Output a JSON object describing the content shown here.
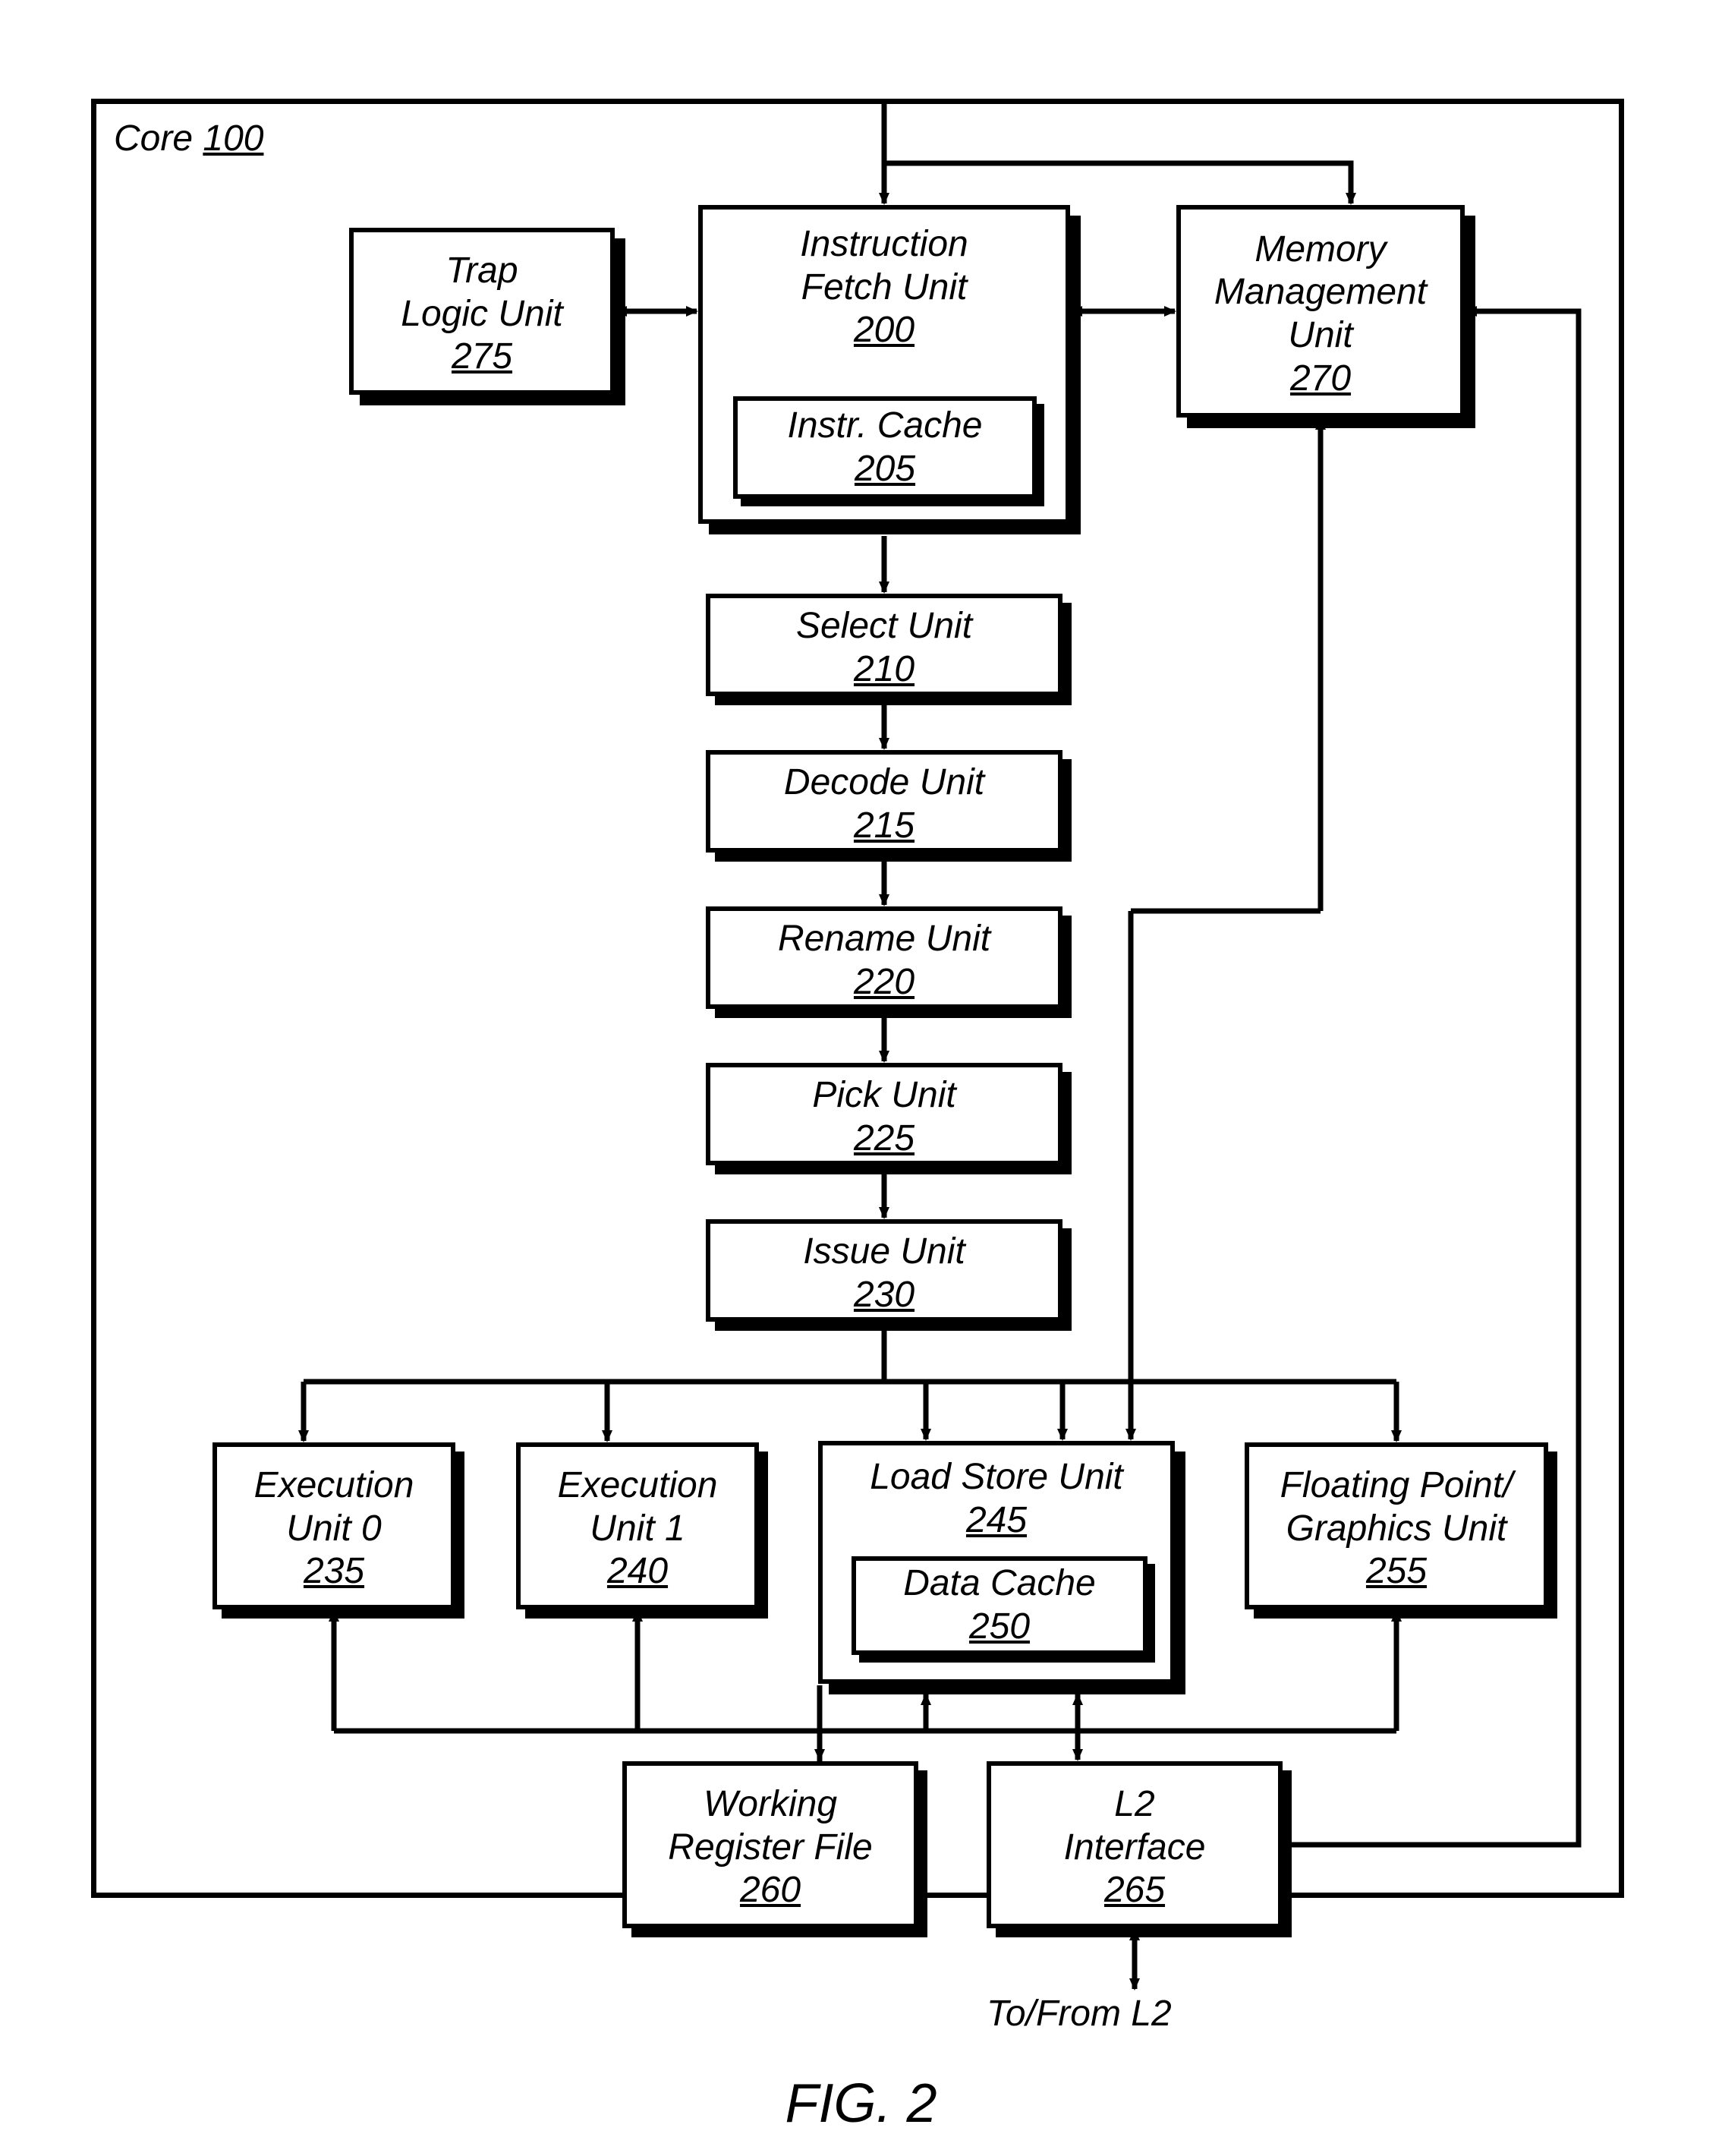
{
  "figure_label": "FIG. 2",
  "core": {
    "label_prefix": "Core ",
    "ref": "100"
  },
  "bottom_label": "To/From L2",
  "blocks": {
    "tlu": {
      "l1": "Trap",
      "l2": "Logic Unit",
      "ref": "275"
    },
    "ifu": {
      "l1": "Instruction",
      "l2": "Fetch Unit",
      "ref": "200"
    },
    "icache": {
      "l1": "Instr. Cache",
      "ref": "205"
    },
    "mmu": {
      "l1": "Memory",
      "l2": "Management",
      "l3": "Unit",
      "ref": "270"
    },
    "select": {
      "l1": "Select Unit",
      "ref": "210"
    },
    "decode": {
      "l1": "Decode Unit",
      "ref": "215"
    },
    "rename": {
      "l1": "Rename Unit",
      "ref": "220"
    },
    "pick": {
      "l1": "Pick Unit",
      "ref": "225"
    },
    "issue": {
      "l1": "Issue Unit",
      "ref": "230"
    },
    "exu0": {
      "l1": "Execution",
      "l2": "Unit 0",
      "ref": "235"
    },
    "exu1": {
      "l1": "Execution",
      "l2": "Unit 1",
      "ref": "240"
    },
    "lsu": {
      "l1": "Load Store Unit",
      "ref": "245"
    },
    "dcache": {
      "l1": "Data Cache",
      "ref": "250"
    },
    "fgu": {
      "l1": "Floating Point/",
      "l2": "Graphics Unit",
      "ref": "255"
    },
    "wrf": {
      "l1": "Working",
      "l2": "Register File",
      "ref": "260"
    },
    "l2if": {
      "l1": "L2",
      "l2": "Interface",
      "ref": "265"
    }
  },
  "chart_data": {
    "type": "diagram",
    "title": "Core 100 block diagram",
    "nodes": [
      {
        "id": "tlu",
        "label": "Trap Logic Unit",
        "ref": "275"
      },
      {
        "id": "ifu",
        "label": "Instruction Fetch Unit",
        "ref": "200",
        "children": [
          {
            "id": "icache",
            "label": "Instr. Cache",
            "ref": "205"
          }
        ]
      },
      {
        "id": "mmu",
        "label": "Memory Management Unit",
        "ref": "270"
      },
      {
        "id": "select",
        "label": "Select Unit",
        "ref": "210"
      },
      {
        "id": "decode",
        "label": "Decode Unit",
        "ref": "215"
      },
      {
        "id": "rename",
        "label": "Rename Unit",
        "ref": "220"
      },
      {
        "id": "pick",
        "label": "Pick Unit",
        "ref": "225"
      },
      {
        "id": "issue",
        "label": "Issue Unit",
        "ref": "230"
      },
      {
        "id": "exu0",
        "label": "Execution Unit 0",
        "ref": "235"
      },
      {
        "id": "exu1",
        "label": "Execution Unit 1",
        "ref": "240"
      },
      {
        "id": "lsu",
        "label": "Load Store Unit",
        "ref": "245",
        "children": [
          {
            "id": "dcache",
            "label": "Data Cache",
            "ref": "250"
          }
        ]
      },
      {
        "id": "fgu",
        "label": "Floating Point/Graphics Unit",
        "ref": "255"
      },
      {
        "id": "wrf",
        "label": "Working Register File",
        "ref": "260"
      },
      {
        "id": "l2if",
        "label": "L2 Interface",
        "ref": "265"
      }
    ],
    "edges": [
      {
        "from": "tlu",
        "to": "ifu",
        "dir": "both"
      },
      {
        "from": "ifu",
        "to": "mmu",
        "dir": "both"
      },
      {
        "from": "ifu",
        "to": "select",
        "dir": "forward"
      },
      {
        "from": "select",
        "to": "decode",
        "dir": "forward"
      },
      {
        "from": "decode",
        "to": "rename",
        "dir": "forward"
      },
      {
        "from": "rename",
        "to": "pick",
        "dir": "forward"
      },
      {
        "from": "pick",
        "to": "issue",
        "dir": "forward"
      },
      {
        "from": "issue",
        "to": "exu0",
        "dir": "forward"
      },
      {
        "from": "issue",
        "to": "exu1",
        "dir": "forward"
      },
      {
        "from": "issue",
        "to": "lsu",
        "dir": "forward"
      },
      {
        "from": "issue",
        "to": "fgu",
        "dir": "forward"
      },
      {
        "from": "exu0",
        "to": "wrf",
        "dir": "both"
      },
      {
        "from": "exu1",
        "to": "wrf",
        "dir": "both"
      },
      {
        "from": "lsu",
        "to": "wrf",
        "dir": "both"
      },
      {
        "from": "fgu",
        "to": "wrf",
        "dir": "both"
      },
      {
        "from": "lsu",
        "to": "l2if",
        "dir": "both"
      },
      {
        "from": "lsu",
        "to": "mmu",
        "dir": "both"
      },
      {
        "from": "l2if",
        "to": "mmu",
        "dir": "forward"
      },
      {
        "from": "l2if",
        "to": "external_L2",
        "dir": "both"
      },
      {
        "from": "external_top",
        "to": "ifu",
        "dir": "forward"
      },
      {
        "from": "external_top",
        "to": "mmu",
        "dir": "forward"
      }
    ]
  }
}
